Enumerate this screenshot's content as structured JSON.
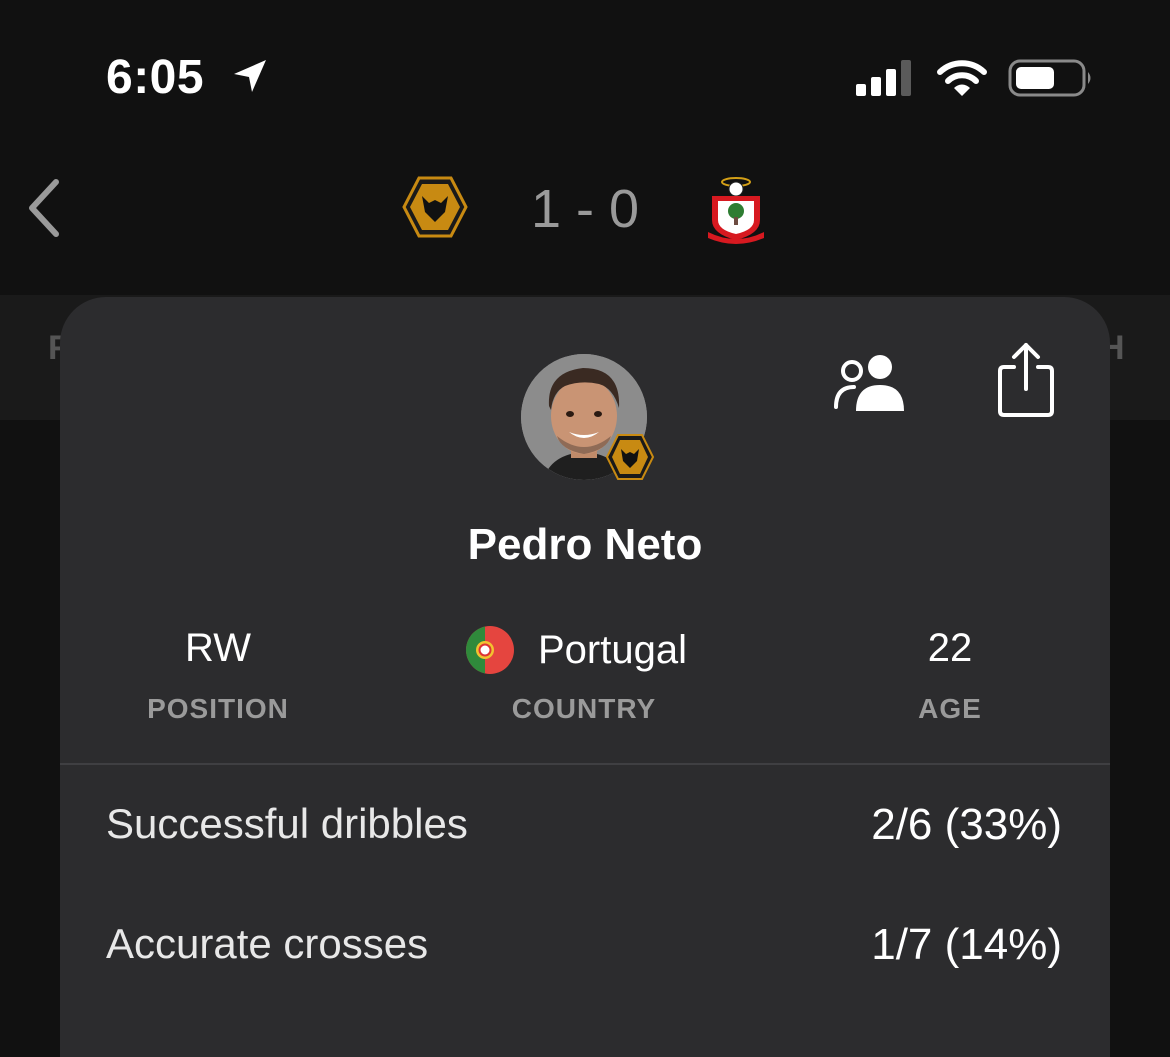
{
  "status_bar": {
    "time": "6:05",
    "icons": [
      "location-arrow-icon",
      "cellular-signal-icon",
      "wifi-icon",
      "battery-icon"
    ]
  },
  "match": {
    "score": "1 - 0",
    "home_crest_icon": "wolves-crest-icon",
    "away_crest_icon": "southampton-crest-icon"
  },
  "background_tabs": {
    "left_fragment": "F",
    "right_fragment": "H"
  },
  "player": {
    "name": "Pedro Neto",
    "position_value": "RW",
    "position_label": "POSITION",
    "country_value": "Portugal",
    "country_label": "COUNTRY",
    "age_value": "22",
    "age_label": "AGE"
  },
  "stats": [
    {
      "label": "Successful dribbles",
      "value": "2/6 (33%)"
    },
    {
      "label": "Accurate crosses",
      "value": "1/7 (14%)"
    }
  ],
  "colors": {
    "background": "#111111",
    "card": "#2c2c2e",
    "muted_text": "#9a9a9a",
    "wolves_gold": "#c88a12"
  }
}
